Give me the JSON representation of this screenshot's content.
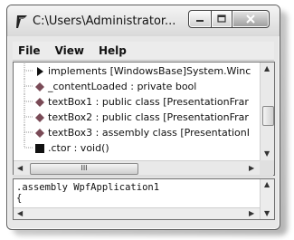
{
  "window": {
    "title": "C:\\Users\\Administrator...",
    "minimize_icon": "minimize-icon",
    "maximize_icon": "maximize-icon",
    "close_icon": "close-icon"
  },
  "menu": {
    "items": [
      {
        "label": "File"
      },
      {
        "label": "View"
      },
      {
        "label": "Help"
      }
    ]
  },
  "tree": {
    "rows": [
      {
        "icon": "black-triangle-icon",
        "label": "implements [WindowsBase]System.Winc"
      },
      {
        "icon": "field-diamond-icon",
        "label": "_contentLoaded : private bool"
      },
      {
        "icon": "field-diamond-icon",
        "label": "textBox1 : public class [PresentationFrar"
      },
      {
        "icon": "field-diamond-icon",
        "label": "textBox2 : public class [PresentationFrar"
      },
      {
        "icon": "field-diamond-icon",
        "label": "textBox3 : assembly class [PresentationI"
      },
      {
        "icon": "method-square-icon",
        "label": ".ctor : void()"
      }
    ],
    "hscroll_grip": "III"
  },
  "code": {
    "lines": [
      ".assembly WpfApplication1",
      "{"
    ]
  },
  "colors": {
    "field_icon": "#7a4b57",
    "method_icon": "#111111",
    "close_button": "#9a9a9a"
  }
}
